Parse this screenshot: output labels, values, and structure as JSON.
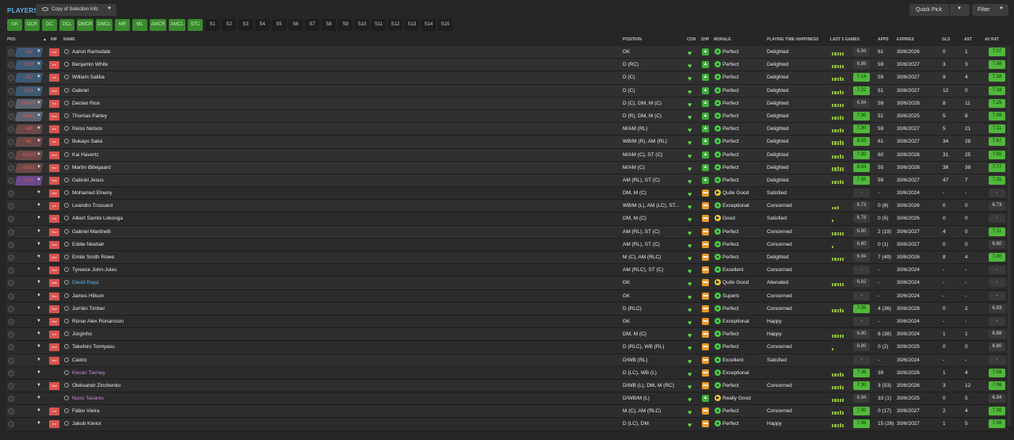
{
  "header": {
    "title": "PLAYERS",
    "view_label": "Copy of Selection Info",
    "quick_pick": "Quick Pick",
    "filter": "Filter"
  },
  "pills": [
    "GK",
    "DCR",
    "DC",
    "DCL",
    "DMCR",
    "DMCL",
    "MR",
    "ML",
    "AMCR",
    "AMCL",
    "STC",
    "S1",
    "S2",
    "S3",
    "S4",
    "S5",
    "S6",
    "S7",
    "S8",
    "S9",
    "S10",
    "S11",
    "S12",
    "S13",
    "S14",
    "S15"
  ],
  "columns": {
    "pkd": "PKD",
    "inf": "INF",
    "name": "NAME",
    "position": "POSITION",
    "con": "CON",
    "shp": "SHP",
    "morale": "MORALE",
    "ptime": "PLAYING TIME HAPPINESS",
    "last5": "LAST 5 GAMES",
    "apps": "APPS",
    "expires": "EXPIRES",
    "gls": "GLS",
    "ast": "AST",
    "avrat": "AV RAT"
  },
  "colors": {
    "accent": "#5fb8e8",
    "green": "#4fb83a",
    "pill_green": "#3a8a2e",
    "inf_red": "#d9534f",
    "heart": "#5fd84a"
  },
  "players": [
    {
      "slot": "GK",
      "inf": "Int",
      "name": "Aaron Ramsdale",
      "position": "GK",
      "shp": "green",
      "morale_icon": "green",
      "morale": "Perfect",
      "ptime": "Delighted",
      "last5": [
        4,
        4,
        4,
        4,
        4
      ],
      "form": "6.94",
      "formg": false,
      "apps": "61",
      "expires": "30/6/2026",
      "gls": "0",
      "ast": "1",
      "avrat": "7.07",
      "avg": true
    },
    {
      "slot": "DCR",
      "inf": "Int",
      "name": "Benjamin White",
      "position": "D (RC)",
      "shp": "green",
      "morale_icon": "green",
      "morale": "Perfect",
      "ptime": "Delighted",
      "last5": [
        4,
        4,
        4,
        4,
        4
      ],
      "form": "6.86",
      "formg": false,
      "apps": "59",
      "expires": "30/6/2027",
      "gls": "3",
      "ast": "3",
      "avrat": "7.08",
      "avg": true
    },
    {
      "slot": "DC",
      "inf": "Int",
      "name": "William Saliba",
      "position": "D (C)",
      "shp": "green",
      "morale_icon": "green",
      "morale": "Perfect",
      "ptime": "Delighted",
      "last5": [
        4,
        4,
        4,
        5,
        4
      ],
      "form": "7.14",
      "formg": true,
      "apps": "59",
      "expires": "30/6/2027",
      "gls": "9",
      "ast": "4",
      "avrat": "7.28",
      "avg": true
    },
    {
      "slot": "DCL",
      "inf": "Hol",
      "name": "Gabriel",
      "position": "D (C)",
      "shp": "green",
      "morale_icon": "green",
      "morale": "Perfect",
      "ptime": "Delighted",
      "last5": [
        4,
        4,
        4,
        5,
        4
      ],
      "form": "7.22",
      "formg": true,
      "apps": "51",
      "expires": "30/6/2027",
      "gls": "12",
      "ast": "0",
      "avrat": "7.18",
      "avg": true
    },
    {
      "slot": "DMCR",
      "inf": "Int",
      "name": "Declan Rice",
      "position": "D (C), DM, M (C)",
      "shp": "green",
      "morale_icon": "green",
      "morale": "Perfect",
      "ptime": "Delighted",
      "last5": [
        4,
        4,
        4,
        4,
        4
      ],
      "form": "6.94",
      "formg": false,
      "apps": "59",
      "expires": "30/6/2028",
      "gls": "8",
      "ast": "11",
      "avrat": "7.25",
      "avg": true
    },
    {
      "slot": "DMCL",
      "inf": "Hol",
      "name": "Thomas Partey",
      "position": "D (R), DM, M (C)",
      "shp": "green",
      "morale_icon": "green",
      "morale": "Perfect",
      "ptime": "Delighted",
      "last5": [
        4,
        4,
        4,
        5,
        4
      ],
      "form": "7.00",
      "formg": true,
      "apps": "51",
      "expires": "30/6/2025",
      "gls": "5",
      "ast": "8",
      "avrat": "7.08",
      "avg": true
    },
    {
      "slot": "MR",
      "inf": "Int",
      "name": "Reiss Nelson",
      "position": "M/AM (RL)",
      "shp": "green",
      "morale_icon": "green",
      "morale": "Perfect",
      "ptime": "Delighted",
      "last5": [
        4,
        4,
        4,
        5,
        4
      ],
      "form": "7.30",
      "formg": true,
      "apps": "59",
      "expires": "30/6/2027",
      "gls": "5",
      "ast": "21",
      "avrat": "7.11",
      "avg": true
    },
    {
      "slot": "ML",
      "inf": "Int",
      "name": "Bukayo Saka",
      "position": "WB/M (R), AM (RL)",
      "shp": "green",
      "morale_icon": "green",
      "morale": "Perfect",
      "ptime": "Delighted",
      "last5": [
        5,
        5,
        5,
        6,
        5
      ],
      "form": "8.03",
      "formg": true,
      "apps": "61",
      "expires": "30/6/2027",
      "gls": "34",
      "ast": "28",
      "avrat": "7.67",
      "avg": true
    },
    {
      "slot": "AMCR",
      "inf": "Hol",
      "name": "Kai Havertz",
      "position": "M/AM (C), ST (C)",
      "shp": "green",
      "morale_icon": "green",
      "morale": "Perfect",
      "ptime": "Delighted",
      "last5": [
        4,
        4,
        4,
        5,
        4
      ],
      "form": "7.30",
      "formg": true,
      "apps": "60",
      "expires": "30/6/2028",
      "gls": "31",
      "ast": "25",
      "avrat": "7.65",
      "avg": true
    },
    {
      "slot": "AMCL",
      "inf": "Hol",
      "name": "Martin Ødegaard",
      "position": "M/AM (C)",
      "shp": "green",
      "morale_icon": "green",
      "morale": "Perfect",
      "ptime": "Delighted",
      "last5": [
        5,
        5,
        6,
        5,
        5
      ],
      "form": "8.03",
      "formg": true,
      "apps": "55",
      "expires": "30/6/2028",
      "gls": "36",
      "ast": "38",
      "avrat": "7.77",
      "avg": true
    },
    {
      "slot": "STC",
      "inf": "Hol",
      "name": "Gabriel Jesus",
      "position": "AM (RL), ST (C)",
      "shp": "green",
      "morale_icon": "green",
      "morale": "Perfect",
      "ptime": "Delighted",
      "last5": [
        4,
        4,
        4,
        5,
        4
      ],
      "form": "7.50",
      "formg": true,
      "apps": "59",
      "expires": "30/6/2027",
      "gls": "47",
      "ast": "7",
      "avrat": "7.31",
      "avg": true
    },
    {
      "slot": "",
      "inf": "Hol",
      "name": "Mohamed Elneny",
      "position": "DM, M (C)",
      "shp": "orange",
      "morale_icon": "yellow",
      "morale": "Quite Good",
      "ptime": "Satisfied",
      "last5": [],
      "form": "-",
      "formg": false,
      "apps": "-",
      "expires": "30/6/2024",
      "gls": "-",
      "ast": "-",
      "avrat": "-",
      "avg": false
    },
    {
      "slot": "",
      "inf": "Int",
      "name": "Leandro Trossard",
      "position": "WB/M (L), AM (LC), ST...",
      "shp": "orange",
      "morale_icon": "green",
      "morale": "Exceptional",
      "ptime": "Concerned",
      "last5": [
        3,
        3,
        4
      ],
      "form": "6.73",
      "formg": false,
      "apps": "0 (8)",
      "expires": "30/6/2026",
      "gls": "0",
      "ast": "0",
      "avrat": "6.73",
      "avg": false
    },
    {
      "slot": "",
      "inf": "Int",
      "name": "Albert Sambi Lokonga",
      "position": "DM, M (C)",
      "shp": "orange",
      "morale_icon": "yellow",
      "morale": "Good",
      "ptime": "Satisfied",
      "last5": [
        3
      ],
      "form": "6.78",
      "formg": false,
      "apps": "0 (5)",
      "expires": "30/6/2026",
      "gls": "0",
      "ast": "0",
      "avrat": "-",
      "avg": false
    },
    {
      "slot": "",
      "inf": "Hol",
      "name": "Gabriel Martinelli",
      "position": "AM (RL), ST (C)",
      "shp": "orange",
      "morale_icon": "green",
      "morale": "Perfect",
      "ptime": "Concerned",
      "last5": [
        4,
        4,
        4,
        4,
        4
      ],
      "form": "6.80",
      "formg": false,
      "apps": "2 (19)",
      "expires": "30/6/2027",
      "gls": "4",
      "ast": "0",
      "avrat": "7.11",
      "avg": true
    },
    {
      "slot": "",
      "inf": "Hol",
      "name": "Eddie Nketiah",
      "position": "AM (RL), ST (C)",
      "shp": "orange",
      "morale_icon": "green",
      "morale": "Perfect",
      "ptime": "Concerned",
      "last5": [
        3
      ],
      "form": "6.60",
      "formg": false,
      "apps": "0 (1)",
      "expires": "30/6/2027",
      "gls": "0",
      "ast": "0",
      "avrat": "6.60",
      "avg": false
    },
    {
      "slot": "",
      "inf": "Hol",
      "name": "Emile Smith Rowe",
      "position": "M (C), AM (RLC)",
      "shp": "orange",
      "morale_icon": "green",
      "morale": "Perfect",
      "ptime": "Delighted",
      "last5": [
        4,
        4,
        4,
        4,
        4
      ],
      "form": "6.94",
      "formg": false,
      "apps": "7 (49)",
      "expires": "30/6/2026",
      "gls": "8",
      "ast": "4",
      "avrat": "7.00",
      "avg": true
    },
    {
      "slot": "",
      "inf": "Hol",
      "name": "Tyreece John-Jules",
      "position": "AM (RLC), ST (C)",
      "shp": "orange",
      "morale_icon": "green",
      "morale": "Excellent",
      "ptime": "Concerned",
      "last5": [],
      "form": "-",
      "formg": false,
      "apps": "-",
      "expires": "30/6/2024",
      "gls": "-",
      "ast": "-",
      "avrat": "-",
      "avg": false
    },
    {
      "slot": "",
      "inf": "Unk",
      "name": "David Raya",
      "name_class": "blue",
      "position": "GK",
      "shp": "orange",
      "morale_icon": "yellow",
      "morale": "Quite Good",
      "ptime": "Alienated",
      "last5": [
        4,
        4,
        4,
        4,
        4
      ],
      "form": "6.82",
      "formg": false,
      "apps": "-",
      "expires": "30/6/2024",
      "gls": "-",
      "ast": "-",
      "avrat": "-",
      "avg": false
    },
    {
      "slot": "",
      "inf": "Hol",
      "name": "James Hillson",
      "position": "GK",
      "shp": "orange",
      "morale_icon": "green",
      "morale": "Superb",
      "ptime": "Concerned",
      "last5": [],
      "form": "-",
      "formg": false,
      "apps": "-",
      "expires": "30/6/2024",
      "gls": "-",
      "ast": "-",
      "avrat": "-",
      "avg": false
    },
    {
      "slot": "",
      "inf": "Hol",
      "name": "Jurriën Timber",
      "position": "D (RLC)",
      "shp": "orange",
      "morale_icon": "green",
      "morale": "Perfect",
      "ptime": "Concerned",
      "last5": [
        4,
        4,
        4,
        5,
        4
      ],
      "form": "7.05",
      "formg": true,
      "apps": "4 (36)",
      "expires": "30/6/2028",
      "gls": "0",
      "ast": "2",
      "avrat": "6.93",
      "avg": false
    },
    {
      "slot": "",
      "inf": "Hol",
      "name": "Rúnar Alex Rúnarsson",
      "position": "GK",
      "shp": "orange",
      "morale_icon": "green",
      "morale": "Exceptional",
      "ptime": "Happy",
      "last5": [],
      "form": "-",
      "formg": false,
      "apps": "-",
      "expires": "30/6/2024",
      "gls": "-",
      "ast": "-",
      "avrat": "-",
      "avg": false
    },
    {
      "slot": "",
      "inf": "Int",
      "name": "Jorginho",
      "position": "DM, M (C)",
      "shp": "orange",
      "morale_icon": "green",
      "morale": "Perfect",
      "ptime": "Happy",
      "last5": [
        4,
        4,
        4,
        4,
        4
      ],
      "form": "6.90",
      "formg": false,
      "apps": "6 (38)",
      "expires": "30/6/2024",
      "gls": "1",
      "ast": "1",
      "avrat": "6.88",
      "avg": false
    },
    {
      "slot": "",
      "inf": "Hol",
      "name": "Takehiro Tomiyasu",
      "position": "D (RLC), WB (RL)",
      "shp": "orange",
      "morale_icon": "green",
      "morale": "Perfect",
      "ptime": "Concerned",
      "last5": [
        3
      ],
      "form": "6.80",
      "formg": false,
      "apps": "0 (2)",
      "expires": "30/6/2025",
      "gls": "0",
      "ast": "0",
      "avrat": "6.80",
      "avg": false
    },
    {
      "slot": "",
      "inf": "Hol",
      "name": "Cédric",
      "position": "D/WB (RL)",
      "shp": "orange",
      "morale_icon": "green",
      "morale": "Excellent",
      "ptime": "Satisfied",
      "last5": [],
      "form": "-",
      "formg": false,
      "apps": "-",
      "expires": "30/6/2024",
      "gls": "-",
      "ast": "-",
      "avrat": "-",
      "avg": false
    },
    {
      "slot": "",
      "inf": "",
      "name": "Kieran Tierney",
      "name_class": "purple",
      "position": "D (LC), WB (L)",
      "shp": "orange",
      "morale_icon": "green",
      "morale": "Exceptional",
      "ptime": "",
      "last5": [
        4,
        4,
        4,
        5,
        4
      ],
      "form": "7.36",
      "formg": true,
      "apps": "39",
      "expires": "30/6/2026",
      "gls": "1",
      "ast": "4",
      "avrat": "7.09",
      "avg": true
    },
    {
      "slot": "",
      "inf": "Hol",
      "name": "Oleksandr Zinchenko",
      "position": "D/WB (L), DM, M (RC)",
      "shp": "orange",
      "morale_icon": "green",
      "morale": "Perfect",
      "ptime": "Concerned",
      "last5": [
        4,
        4,
        4,
        5,
        4
      ],
      "form": "7.30",
      "formg": true,
      "apps": "3 (53)",
      "expires": "30/6/2026",
      "gls": "3",
      "ast": "12",
      "avrat": "7.06",
      "avg": true
    },
    {
      "slot": "",
      "inf": "",
      "name": "Nuno Tavares",
      "name_class": "purple",
      "position": "D/WB/M (L)",
      "shp": "green",
      "morale_icon": "yellow",
      "morale": "Really Good",
      "ptime": "",
      "last5": [
        4,
        4,
        4,
        4,
        4
      ],
      "form": "6.94",
      "formg": false,
      "apps": "33 (1)",
      "expires": "30/6/2025",
      "gls": "0",
      "ast": "5",
      "avrat": "6.94",
      "avg": false
    },
    {
      "slot": "",
      "inf": "Int",
      "name": "Fábio Vieira",
      "position": "M (C), AM (RLC)",
      "shp": "orange",
      "morale_icon": "green",
      "morale": "Perfect",
      "ptime": "Concerned",
      "last5": [
        4,
        4,
        4,
        5,
        4
      ],
      "form": "7.00",
      "formg": true,
      "apps": "0 (17)",
      "expires": "30/6/2027",
      "gls": "2",
      "ast": "4",
      "avrat": "7.08",
      "avg": true
    },
    {
      "slot": "",
      "inf": "Int",
      "name": "Jakub Kiwior",
      "position": "D (LC), DM",
      "shp": "orange",
      "morale_icon": "green",
      "morale": "Perfect",
      "ptime": "Happy",
      "last5": [
        4,
        4,
        4,
        5,
        4
      ],
      "form": "7.06",
      "formg": true,
      "apps": "15 (26)",
      "expires": "30/6/2027",
      "gls": "1",
      "ast": "5",
      "avrat": "7.08",
      "avg": true
    }
  ]
}
